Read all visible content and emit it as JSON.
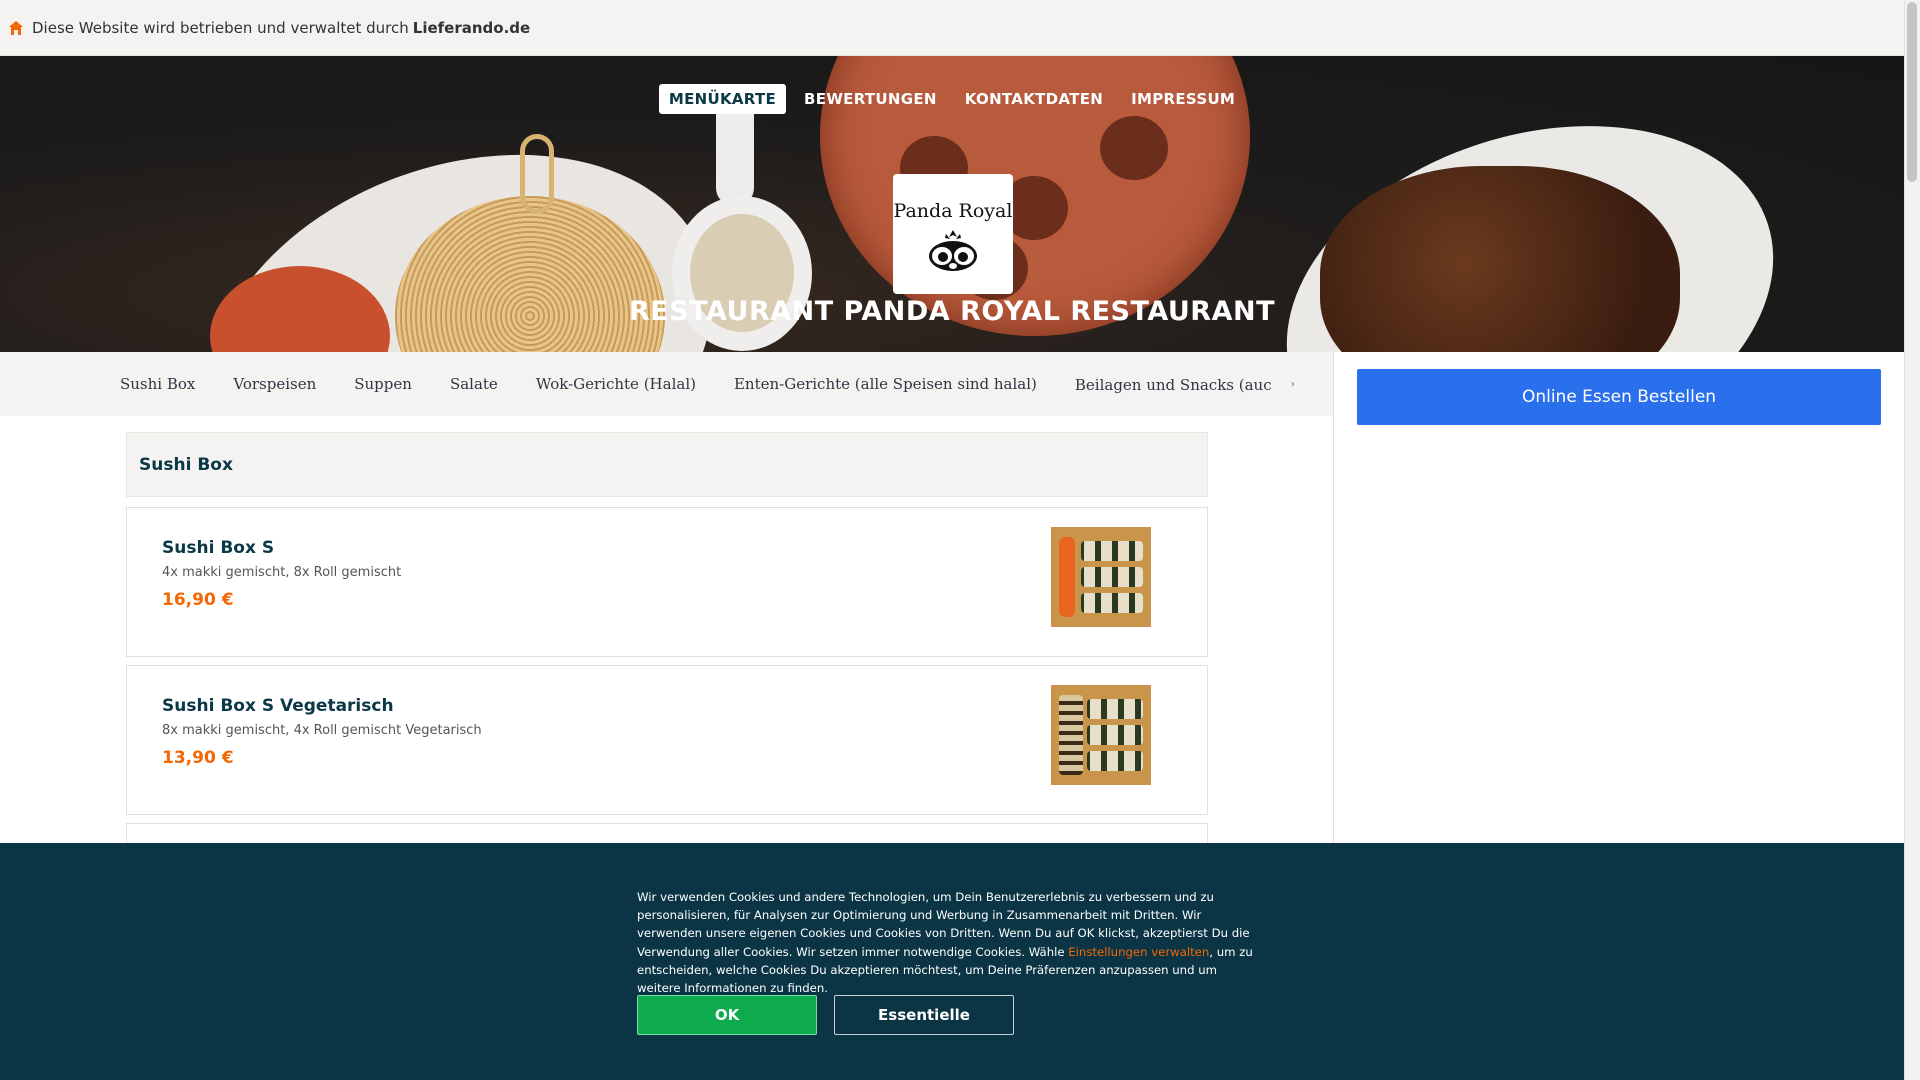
{
  "notice": {
    "text": "Diese Website wird betrieben und verwaltet durch",
    "brand": "Lieferando.de",
    "icon": "home-icon",
    "icon_color": "#f36805"
  },
  "nav": {
    "items": [
      {
        "label": "MENÜKARTE",
        "active": true
      },
      {
        "label": "BEWERTUNGEN"
      },
      {
        "label": "KONTAKTDATEN"
      },
      {
        "label": "IMPRESSUM"
      }
    ]
  },
  "hero": {
    "logo_text": "Panda Royal",
    "title": "RESTAURANT PANDA ROYAL RESTAURANT"
  },
  "categories": {
    "items": [
      "Sushi Box",
      "Vorspeisen",
      "Suppen",
      "Salate",
      "Wok-Gerichte (Halal)",
      "Enten-Gerichte (alle Speisen sind halal)",
      "Beilagen und Snacks (auch Halal)"
    ],
    "more_icon": "chevron-right-icon"
  },
  "menu": {
    "section_title": "Sushi Box",
    "items": [
      {
        "name": "Sushi Box S",
        "description": "4x makki gemischt, 8x Roll gemischt",
        "price": "16,90 €"
      },
      {
        "name": "Sushi Box S Vegetarisch",
        "description": "8x makki gemischt, 4x Roll gemischt Vegetarisch",
        "price": "13,90 €"
      }
    ]
  },
  "sidebar": {
    "order_button": "Online Essen Bestellen",
    "accent": "#2a70ec"
  },
  "cookie": {
    "text_before": "Wir verwenden Cookies und andere Technologien, um Dein Benutzererlebnis zu verbessern und zu personalisieren, für Analysen zur Optimierung und Werbung in Zusammenarbeit mit Dritten. Wir verwenden unsere eigenen Cookies und Cookies von Dritten. Wenn Du auf OK klickst, akzeptierst Du die Verwendung aller Cookies. Wir setzen immer notwendige Cookies. Wähle ",
    "link": "Einstellungen verwalten",
    "text_after": ", um zu entscheiden, welche Cookies Du akzeptieren möchtest, um Deine Präferenzen anzupassen und um weitere Informationen zu finden.",
    "ok_label": "OK",
    "essential_label": "Essentielle",
    "bg": "#0b3545",
    "ok_color": "#0dab4d"
  }
}
